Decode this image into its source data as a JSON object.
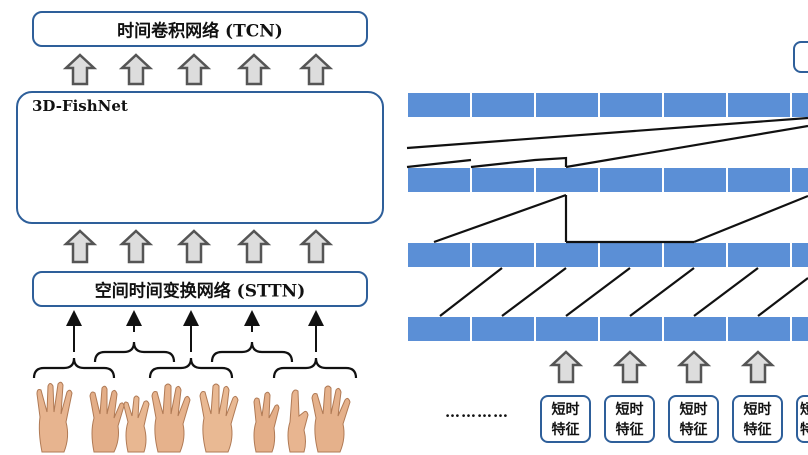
{
  "top_module": {
    "label": "时间卷积网络 (TCN)"
  },
  "middle_module": {
    "label": "3D-FishNet"
  },
  "bottom_module": {
    "label": "空间时间变换网络 (STTN)"
  },
  "right_panel": {
    "ellipsis": "…………",
    "feature_boxes": [
      {
        "line1": "短时",
        "line2": "特征"
      },
      {
        "line1": "短时",
        "line2": "特征"
      },
      {
        "line1": "短时",
        "line2": "特征"
      },
      {
        "line1": "短时",
        "line2": "特征"
      },
      {
        "line1": "短",
        "line2": "特"
      }
    ]
  },
  "colors": {
    "box_border": "#2e5f9a",
    "cell_fill": "#5b8fd6",
    "block_blue": "#5b8fd6",
    "block_light_blue": "#b8d4f0",
    "block_yellow": "#f7f0b0",
    "arrow_fill": "#cccccc"
  }
}
